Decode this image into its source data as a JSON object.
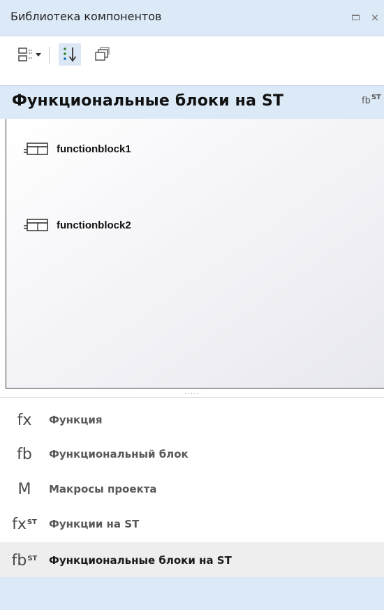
{
  "panel": {
    "title": "Библиотека компонентов"
  },
  "toolbar": {
    "view_menu_icon": "list-view-icon",
    "sort_icon": "sort-icon",
    "collapse_icon": "collapse-all-icon"
  },
  "section": {
    "title": "Функциональные блоки на ST",
    "icon_text": "fb",
    "icon_sup": "ST"
  },
  "items": [
    {
      "label": "functionblock1",
      "icon": "function-block-icon"
    },
    {
      "label": "functionblock2",
      "icon": "function-block-icon"
    }
  ],
  "splitter": {
    "grip": "....."
  },
  "categories": [
    {
      "icon_text": "fx",
      "icon_sup": "",
      "label": "Функция",
      "active": false
    },
    {
      "icon_text": "fb",
      "icon_sup": "",
      "label": "Функциональный блок",
      "active": false
    },
    {
      "icon_text": "M",
      "icon_sup": "",
      "label": "Макросы проекта",
      "active": false
    },
    {
      "icon_text": "fx",
      "icon_sup": "ST",
      "label": "Функции на ST",
      "active": false
    },
    {
      "icon_text": "fb",
      "icon_sup": "ST",
      "label": "Функциональные блоки на ST",
      "active": true
    }
  ],
  "colors": {
    "header_bg": "#dce9f7",
    "active_row_bg": "#eeeeee",
    "sort_button_bg": "#dbe7f5"
  }
}
